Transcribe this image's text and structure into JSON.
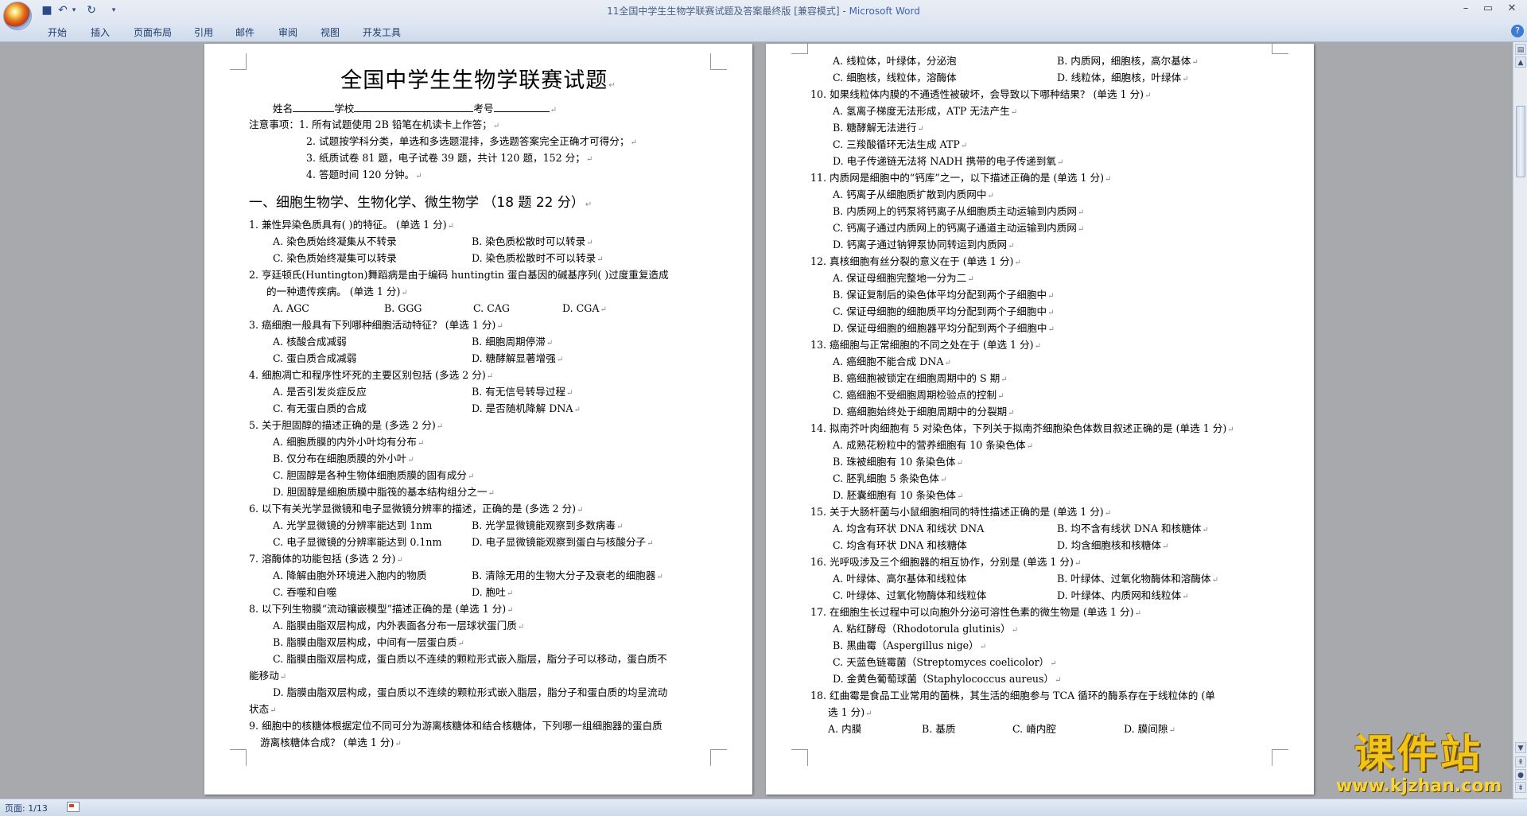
{
  "window": {
    "title_doc": "11全国中学生生物学联赛试题及答案最终版 [兼容模式] - ",
    "title_app": "Microsoft Word"
  },
  "quick_access": {
    "save_icon": "save-icon",
    "undo_icon": "undo-icon",
    "redo_icon": "redo-icon",
    "undo_glyph": "↶",
    "redo_glyph": "↻",
    "save_glyph": "■",
    "more_glyph": "▾"
  },
  "ribbon": {
    "tabs": [
      "开始",
      "插入",
      "页面布局",
      "引用",
      "邮件",
      "审阅",
      "视图",
      "开发工具"
    ]
  },
  "controls": {
    "min": "–",
    "max": "▭",
    "close": "✕",
    "help": "?"
  },
  "page1": {
    "title": "全国中学生生物学联赛试题",
    "header_line": {
      "name": "姓名",
      "school": "学校",
      "exam_no": "考号"
    },
    "notes_label": "注意事项：",
    "notes": [
      "1. 所有试题使用 2B 铅笔在机读卡上作答；",
      "2. 试题按学科分类，单选和多选题混排，多选题答案完全正确才可得分；",
      "3. 纸质试卷 81 题，电子试卷 39 题，共计 120 题，152 分；",
      "4. 答题时间 120 分钟。"
    ],
    "section": "一、细胞生物学、生物化学、微生物学 （18 题 22 分）",
    "questions": {
      "q1": "1. 兼性异染色质具有(       )的特征。  (单选 1 分)",
      "q1a": "A. 染色质始终凝集从不转录",
      "q1b": "B. 染色质松散时可以转录",
      "q1c": "C. 染色质始终凝集可以转录",
      "q1d": "D. 染色质松散时不可以转录",
      "q2": "2. 亨廷顿氏(Huntington)舞蹈病是由于编码 huntingtin 蛋白基因的碱基序列(       )过度重复造成",
      "q2b": "的一种遗传疾病。  (单选 1 分)",
      "q2_a": "A. AGC",
      "q2_b": "B. GGG",
      "q2_c": "C. CAG",
      "q2_d": "D. CGA",
      "q3": "3. 癌细胞一般具有下列哪种细胞活动特征？  (单选 1 分)",
      "q3a": "A. 核酸合成减弱",
      "q3b": "B. 细胞周期停滞",
      "q3c": "C. 蛋白质合成减弱",
      "q3d": "D. 糖酵解显著增强",
      "q4": "4. 细胞凋亡和程序性坏死的主要区别包括  (多选 2 分)",
      "q4a": "A. 是否引发炎症反应",
      "q4b": "B. 有无信号转导过程",
      "q4c": "C. 有无蛋白质的合成",
      "q4d": "D. 是否随机降解 DNA",
      "q5": "5. 关于胆固醇的描述正确的是  (多选 2 分)",
      "q5a": "A. 细胞质膜的内外小叶均有分布",
      "q5b": "B. 仅分布在细胞质膜的外小叶",
      "q5c": "C. 胆固醇是各种生物体细胞质膜的固有成分",
      "q5d": "D. 胆固醇是细胞质膜中脂筏的基本结构组分之一",
      "q6": "6. 以下有关光学显微镜和电子显微镜分辨率的描述，正确的是  (多选 2 分)",
      "q6a": "A. 光学显微镜的分辨率能达到 1nm",
      "q6b": "B. 光学显微镜能观察到多数病毒",
      "q6c": "C. 电子显微镜的分辨率能达到 0.1nm",
      "q6d": "D. 电子显微镜能观察到蛋白与核酸分子",
      "q7": "7. 溶酶体的功能包括  (多选 2 分)",
      "q7a": "A. 降解由胞外环境进入胞内的物质",
      "q7b": "B. 清除无用的生物大分子及衰老的细胞器",
      "q7c": "C. 吞噬和自噬",
      "q7d": "D. 胞吐",
      "q8": "8. 以下列生物膜“流动镶嵌模型”描述正确的是  (单选 1 分)",
      "q8a": "A. 脂膜由脂双层构成，内外表面各分布一层球状蛋门质",
      "q8b": "B. 脂膜由脂双层构成，中间有一层蛋白质",
      "q8c1": "C. 脂膜由脂双层构成，蛋白质以不连续的颗粒形式嵌入脂层，脂分子可以移动，蛋白质不",
      "q8c2": "能移动",
      "q8d1": "D. 脂膜由脂双层构成，蛋白质以不连续的颗粒形式嵌入脂层，脂分子和蛋白质的均呈流动",
      "q8d2": "状态",
      "q9_1": "9.  细胞中的核糖体根据定位不同可分为游离核糖体和结合核糖体，下列哪一组细胞器的蛋白质",
      "q9_2": "游离核糖体合成？  (单选 1 分)"
    }
  },
  "page2": {
    "lines": {
      "q9a": "A. 线粒体，叶绿体，分泌泡",
      "q9b": "B. 内质网，细胞核，高尔基体",
      "q9c": "C. 细胞核，线粒体，溶酶体",
      "q9d": "D. 线粒体，细胞核，叶绿体",
      "q10": "10. 如果线粒体内膜的不通透性被破坏，会导致以下哪种结果？  (单选 1 分)",
      "q10a": "A. 氢离子梯度无法形成，ATP 无法产生",
      "q10b": "B. 糖酵解无法进行",
      "q10c": "C. 三羧酸循环无法生成 ATP",
      "q10d": "D. 电子传递链无法将 NADH 携带的电子传递到氧",
      "q11": "11. 内质网是细胞中的“钙库”之一，以下描述正确的是  (单选 1 分)",
      "q11a": "A. 钙离子从细胞质扩散到内质网中",
      "q11b": "B. 内质网上的钙泵将钙离子从细胞质主动运输到内质网",
      "q11c": "C. 钙离子通过内质网上的钙离子通道主动运输到内质网",
      "q11d": "D. 钙离子通过钠钾泵协同转运到内质网",
      "q12": "12. 真核细胞有丝分裂的意义在于  (单选 1 分)",
      "q12a": "A. 保证母细胞完整地一分为二",
      "q12b": "B. 保证复制后的染色体平均分配到两个子细胞中",
      "q12c": "C. 保证母细胞的细胞质平均分配到两个子细胞中",
      "q12d": "D. 保证母细胞的细胞器平均分配到两个子细胞中",
      "q13": "13. 癌细胞与正常细胞的不同之处在于  (单选 1 分)",
      "q13a": "A. 癌细胞不能合成 DNA",
      "q13b": "B. 癌细胞被锁定在细胞周期中的 S 期",
      "q13c": "C. 癌细胞不受细胞周期检验点的控制",
      "q13d": "D. 癌细胞始终处于细胞周期中的分裂期",
      "q14": "14. 拟南芥叶肉细胞有 5 对染色体，下列关于拟南芥细胞染色体数目叙述正确的是  (单选 1 分)",
      "q14a": "A. 成熟花粉粒中的营养细胞有 10 条染色体",
      "q14b": "B. 珠被细胞有 10 条染色体",
      "q14c": "C. 胚乳细胞 5 条染色体",
      "q14d": "D. 胚囊细胞有 10 条染色体",
      "q15": "15. 关于大肠杆菌与小鼠细胞相同的特性描述正确的是  (单选 1 分)",
      "q15a": "A. 均含有环状 DNA 和线状 DNA",
      "q15b": "B. 均不含有线状 DNA 和核糖体",
      "q15c": "C. 均含有环状 DNA 和核糖体",
      "q15d": "D. 均含细胞核和核糖体",
      "q16": "16. 光呼吸涉及三个细胞器的相互协作，分别是  (单选 1 分)",
      "q16a": "A. 叶绿体、高尔基体和线粒体",
      "q16b": "B. 叶绿体、过氧化物酶体和溶酶体",
      "q16c": "C. 叶绿体、过氧化物酶体和线粒体",
      "q16d": "D. 叶绿体、内质网和线粒体",
      "q17": "17. 在细胞生长过程中可以向胞外分泌可溶性色素的微生物是  (单选 1 分)",
      "q17a": "A. 粘红酵母（Rhodotorula glutinis）",
      "q17b": "B. 黑曲霉（Aspergillus nige）",
      "q17c": "C. 天蓝色链霉菌（Streptomyces coelicolor）",
      "q17d": "D. 金黄色葡萄球菌（Staphylococcus aureus）",
      "q18": "18. 红曲霉是食品工业常用的菌株，其生活的细胞参与 TCA 循环的酶系存在于线粒体的  (单",
      "q18b": "选 1 分)",
      "q18_a": "A. 内膜",
      "q18_b": "B. 基质",
      "q18_c": "C. 嵴内腔",
      "q18_d": "D. 膜间隙"
    }
  },
  "status": {
    "page": "页面: 1/13"
  },
  "watermark": {
    "cn": "课件站",
    "url": "www.kjzhan.com"
  },
  "colors": {
    "workspace": "#a7a9ad",
    "ribbon": "#dfe7f3",
    "watermark": "#f2c418"
  }
}
